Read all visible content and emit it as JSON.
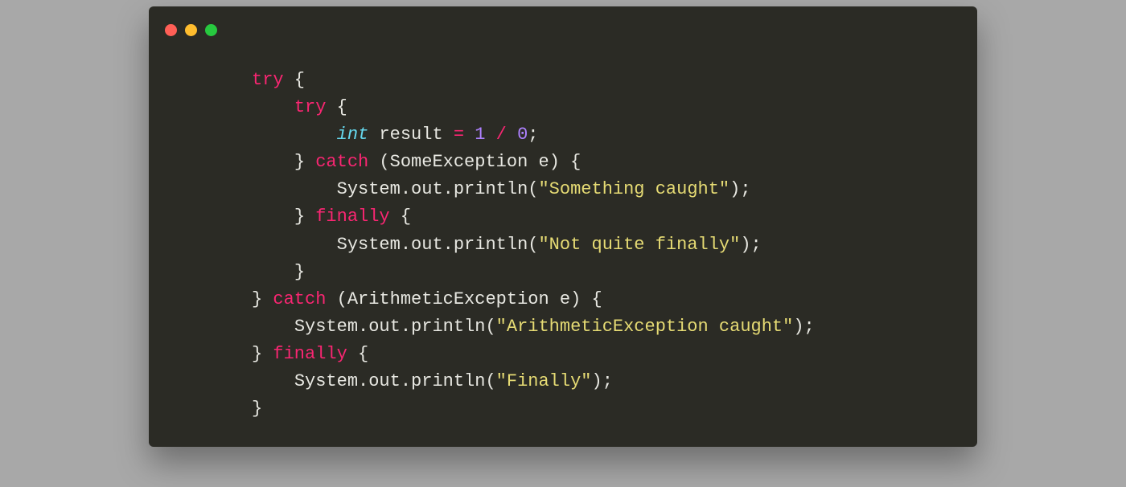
{
  "window": {
    "traffic_lights": [
      "red",
      "yellow",
      "green"
    ]
  },
  "colors": {
    "background": "#2b2b25",
    "keyword": "#f92672",
    "builtin": "#66d9ef",
    "type": "#a5e22e",
    "number": "#ae81ff",
    "string": "#e6db74",
    "default": "#e8e8e2"
  },
  "code": {
    "language": "java",
    "lines": [
      [
        {
          "t": "keyword",
          "v": "try"
        },
        {
          "t": "punct",
          "v": " {"
        }
      ],
      [
        {
          "t": "indent",
          "v": "    "
        },
        {
          "t": "keyword",
          "v": "try"
        },
        {
          "t": "punct",
          "v": " {"
        }
      ],
      [
        {
          "t": "indent",
          "v": "        "
        },
        {
          "t": "builtin",
          "v": "int"
        },
        {
          "t": "ident",
          "v": " result "
        },
        {
          "t": "keyword",
          "v": "="
        },
        {
          "t": "ident",
          "v": " "
        },
        {
          "t": "number",
          "v": "1"
        },
        {
          "t": "ident",
          "v": " "
        },
        {
          "t": "keyword",
          "v": "/"
        },
        {
          "t": "ident",
          "v": " "
        },
        {
          "t": "number",
          "v": "0"
        },
        {
          "t": "punct",
          "v": ";"
        }
      ],
      [
        {
          "t": "indent",
          "v": "    "
        },
        {
          "t": "punct",
          "v": "} "
        },
        {
          "t": "keyword",
          "v": "catch"
        },
        {
          "t": "punct",
          "v": " ("
        },
        {
          "t": "ident",
          "v": "SomeException e"
        },
        {
          "t": "punct",
          "v": ") {"
        }
      ],
      [
        {
          "t": "indent",
          "v": "        "
        },
        {
          "t": "ident",
          "v": "System"
        },
        {
          "t": "dot",
          "v": "."
        },
        {
          "t": "ident",
          "v": "out"
        },
        {
          "t": "dot",
          "v": "."
        },
        {
          "t": "ident",
          "v": "println"
        },
        {
          "t": "punct",
          "v": "("
        },
        {
          "t": "string",
          "v": "\"Something caught\""
        },
        {
          "t": "punct",
          "v": ");"
        }
      ],
      [
        {
          "t": "indent",
          "v": "    "
        },
        {
          "t": "punct",
          "v": "} "
        },
        {
          "t": "keyword",
          "v": "finally"
        },
        {
          "t": "punct",
          "v": " {"
        }
      ],
      [
        {
          "t": "indent",
          "v": "        "
        },
        {
          "t": "ident",
          "v": "System"
        },
        {
          "t": "dot",
          "v": "."
        },
        {
          "t": "ident",
          "v": "out"
        },
        {
          "t": "dot",
          "v": "."
        },
        {
          "t": "ident",
          "v": "println"
        },
        {
          "t": "punct",
          "v": "("
        },
        {
          "t": "string",
          "v": "\"Not quite finally\""
        },
        {
          "t": "punct",
          "v": ");"
        }
      ],
      [
        {
          "t": "indent",
          "v": "    "
        },
        {
          "t": "punct",
          "v": "}"
        }
      ],
      [
        {
          "t": "punct",
          "v": "} "
        },
        {
          "t": "keyword",
          "v": "catch"
        },
        {
          "t": "punct",
          "v": " ("
        },
        {
          "t": "ident",
          "v": "ArithmeticException e"
        },
        {
          "t": "punct",
          "v": ") {"
        }
      ],
      [
        {
          "t": "indent",
          "v": "    "
        },
        {
          "t": "ident",
          "v": "System"
        },
        {
          "t": "dot",
          "v": "."
        },
        {
          "t": "ident",
          "v": "out"
        },
        {
          "t": "dot",
          "v": "."
        },
        {
          "t": "ident",
          "v": "println"
        },
        {
          "t": "punct",
          "v": "("
        },
        {
          "t": "string",
          "v": "\"ArithmeticException caught\""
        },
        {
          "t": "punct",
          "v": ");"
        }
      ],
      [
        {
          "t": "punct",
          "v": "} "
        },
        {
          "t": "keyword",
          "v": "finally"
        },
        {
          "t": "punct",
          "v": " {"
        }
      ],
      [
        {
          "t": "indent",
          "v": "    "
        },
        {
          "t": "ident",
          "v": "System"
        },
        {
          "t": "dot",
          "v": "."
        },
        {
          "t": "ident",
          "v": "out"
        },
        {
          "t": "dot",
          "v": "."
        },
        {
          "t": "ident",
          "v": "println"
        },
        {
          "t": "punct",
          "v": "("
        },
        {
          "t": "string",
          "v": "\"Finally\""
        },
        {
          "t": "punct",
          "v": ");"
        }
      ],
      [
        {
          "t": "punct",
          "v": "}"
        }
      ]
    ]
  }
}
